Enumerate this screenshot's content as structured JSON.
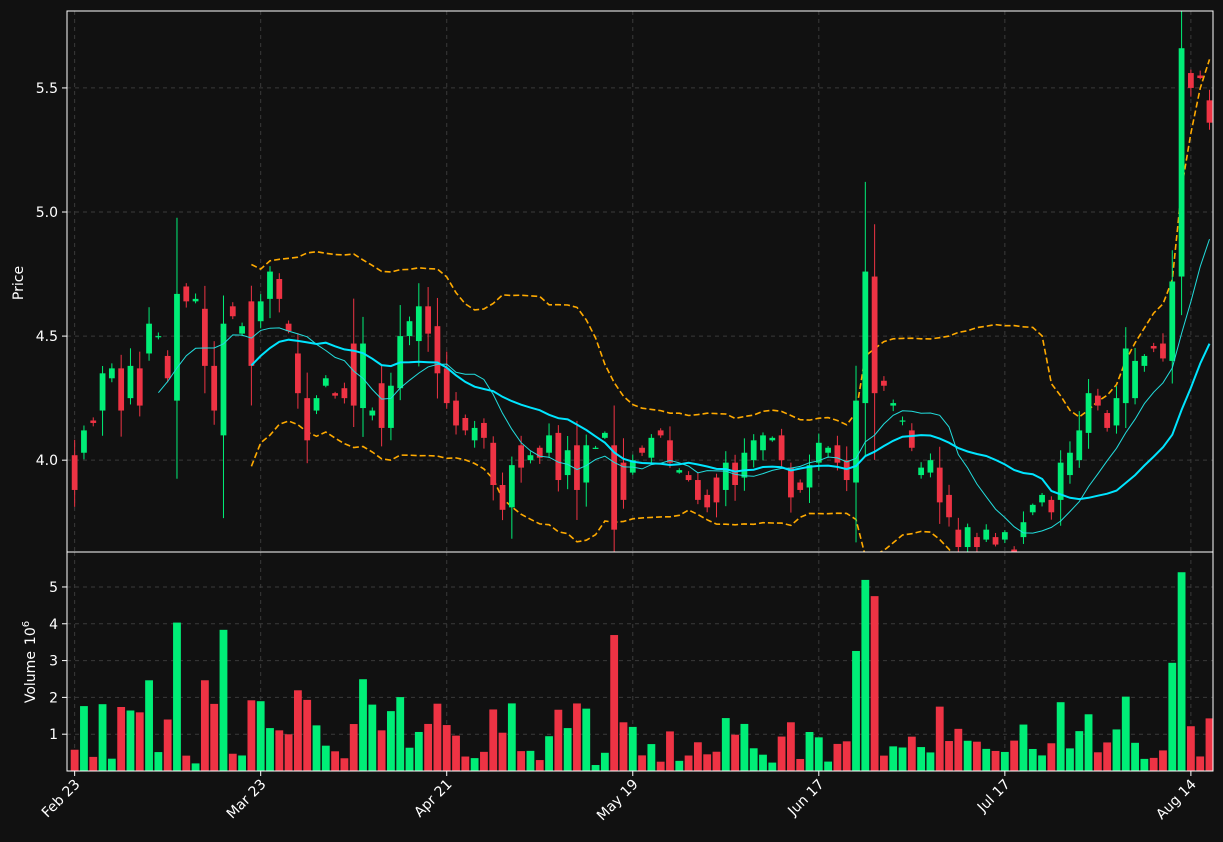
{
  "colors": {
    "background": "#111111",
    "up": "#00ee77",
    "down": "#ee3344",
    "ma_fast": "#22dddd",
    "ma_slow": "#00e5ff",
    "bollinger": "#ffaa00",
    "grid": "#3a3a3a",
    "frame": "#ffffff",
    "text": "#ffffff"
  },
  "chart_data": {
    "type": "candlestick",
    "price_panel": {
      "ylabel": "Price",
      "yticks": [
        "4.0",
        "4.5",
        "5.0",
        "5.5"
      ],
      "ytick_values": [
        4.0,
        4.5,
        5.0,
        5.5
      ],
      "ylim": [
        3.63,
        5.81
      ],
      "grid": true
    },
    "volume_panel": {
      "ylabel": "Volume",
      "ylabel_exponent": "10",
      "ylabel_power": "6",
      "yticks": [
        "1",
        "2",
        "3",
        "4",
        "5"
      ],
      "ytick_values": [
        1,
        2,
        3,
        4,
        5
      ],
      "ylim": [
        0,
        5.95
      ],
      "grid": true
    },
    "xticks": [
      {
        "label": "Feb 23",
        "index": 0
      },
      {
        "label": "Mar 23",
        "index": 20
      },
      {
        "label": "Apr 21",
        "index": 40
      },
      {
        "label": "May 19",
        "index": 60
      },
      {
        "label": "Jun 17",
        "index": 80
      },
      {
        "label": "Jul 17",
        "index": 100
      },
      {
        "label": "Aug 14",
        "index": 120
      }
    ],
    "close": [
      3.88,
      4.12,
      4.15,
      4.35,
      4.37,
      4.2,
      4.38,
      4.22,
      4.55,
      4.5,
      4.33,
      4.67,
      4.64,
      4.65,
      4.38,
      4.2,
      4.55,
      4.58,
      4.54,
      4.38,
      4.64,
      4.76,
      4.65,
      4.52,
      4.27,
      4.08,
      4.25,
      4.33,
      4.26,
      4.25,
      4.22,
      4.47,
      4.2,
      4.13,
      4.3,
      4.5,
      4.56,
      4.62,
      4.51,
      4.35,
      4.23,
      4.14,
      4.12,
      4.13,
      4.09,
      3.9,
      3.8,
      3.98,
      3.97,
      4.02,
      4.01,
      4.1,
      3.92,
      4.04,
      3.88,
      4.06,
      4.05,
      4.11,
      3.72,
      3.84,
      4.0,
      4.03,
      4.09,
      4.1,
      3.99,
      3.96,
      3.92,
      3.84,
      3.81,
      3.83,
      3.99,
      3.9,
      4.03,
      4.08,
      4.1,
      4.09,
      4.0,
      3.85,
      3.88,
      3.98,
      4.07,
      4.05,
      3.99,
      3.92,
      4.24,
      4.76,
      4.27,
      4.3,
      4.23,
      4.16,
      4.05,
      3.97,
      4.0,
      3.83,
      3.77,
      3.65,
      3.73,
      3.65,
      3.72,
      3.66,
      3.71,
      3.6,
      3.75,
      3.82,
      3.86,
      3.79,
      3.99,
      4.03,
      4.12,
      4.27,
      4.22,
      4.13,
      4.25,
      4.45,
      4.4,
      4.42,
      4.45,
      4.41,
      4.72,
      5.66,
      5.5,
      5.54,
      5.36
    ],
    "open": [
      4.02,
      4.03,
      4.16,
      4.2,
      4.33,
      4.37,
      4.25,
      4.37,
      4.43,
      4.5,
      4.42,
      4.24,
      4.7,
      4.64,
      4.61,
      4.38,
      4.1,
      4.62,
      4.51,
      4.64,
      4.56,
      4.65,
      4.73,
      4.55,
      4.43,
      4.25,
      4.2,
      4.3,
      4.27,
      4.29,
      4.47,
      4.21,
      4.18,
      4.31,
      4.13,
      4.29,
      4.5,
      4.48,
      4.62,
      4.54,
      4.37,
      4.24,
      4.17,
      4.08,
      4.15,
      4.07,
      3.9,
      3.81,
      4.06,
      4.0,
      4.05,
      4.03,
      4.11,
      3.94,
      4.06,
      3.91,
      4.05,
      4.09,
      4.06,
      3.99,
      3.95,
      4.05,
      4.01,
      4.12,
      4.08,
      3.95,
      3.94,
      3.92,
      3.86,
      3.93,
      3.88,
      3.99,
      3.93,
      4.0,
      4.04,
      4.08,
      4.1,
      3.97,
      3.91,
      3.89,
      3.99,
      4.03,
      4.06,
      4.0,
      3.91,
      4.23,
      4.74,
      4.32,
      4.22,
      4.16,
      4.12,
      3.94,
      3.95,
      3.97,
      3.86,
      3.72,
      3.65,
      3.69,
      3.68,
      3.69,
      3.68,
      3.64,
      3.69,
      3.79,
      3.83,
      3.84,
      3.84,
      3.94,
      4.0,
      4.11,
      4.26,
      4.19,
      4.14,
      4.23,
      4.25,
      4.38,
      4.46,
      4.47,
      4.4,
      4.74,
      5.56,
      5.55,
      5.45
    ]
  }
}
